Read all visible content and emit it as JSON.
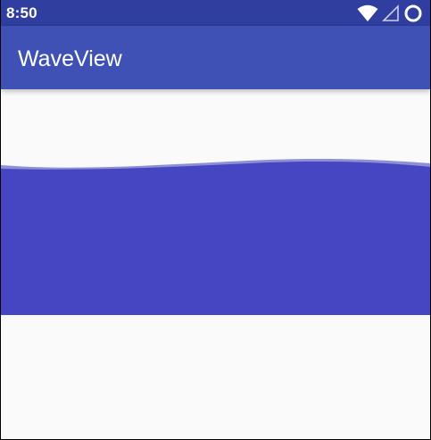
{
  "status_bar": {
    "time": "8:50",
    "icons": [
      "wifi-icon",
      "cell-signal-icon",
      "battery-icon"
    ],
    "color": "#303f9f"
  },
  "app_bar": {
    "title": "WaveView",
    "color": "#3f51b5"
  },
  "wave": {
    "fill_color": "#4646c2",
    "back_wave_color": "#8e90d6",
    "background_color": "#fafafa"
  }
}
